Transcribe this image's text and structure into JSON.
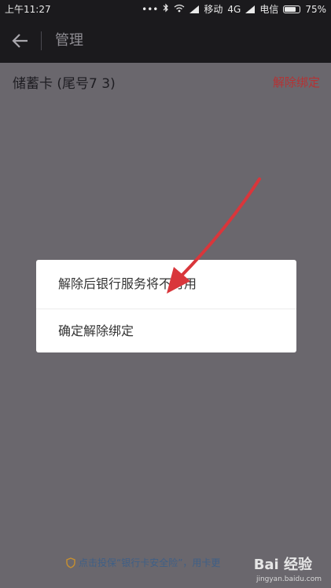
{
  "status_bar": {
    "time": "上午11:27",
    "dots": "•••",
    "carrier1": "移动",
    "network": "4G",
    "carrier2": "电信",
    "battery": "75%"
  },
  "header": {
    "title": "管理"
  },
  "card": {
    "name": "储蓄卡 (尾号7  3)",
    "unbind_label": "解除绑定"
  },
  "dialog": {
    "message": "解除后银行服务将不可用",
    "confirm_label": "确定解除绑定"
  },
  "bottom_notice": {
    "text": "点击投保“银行卡安全险”，用卡更"
  },
  "watermark": {
    "logo": "Bai 经验",
    "url": "jingyan.baidu.com"
  },
  "colors": {
    "accent_red": "#b53234",
    "overlay": "#6a676d",
    "header_bg": "#1b1a1d",
    "link_blue": "#3f5f86",
    "arrow": "#d9363b"
  }
}
